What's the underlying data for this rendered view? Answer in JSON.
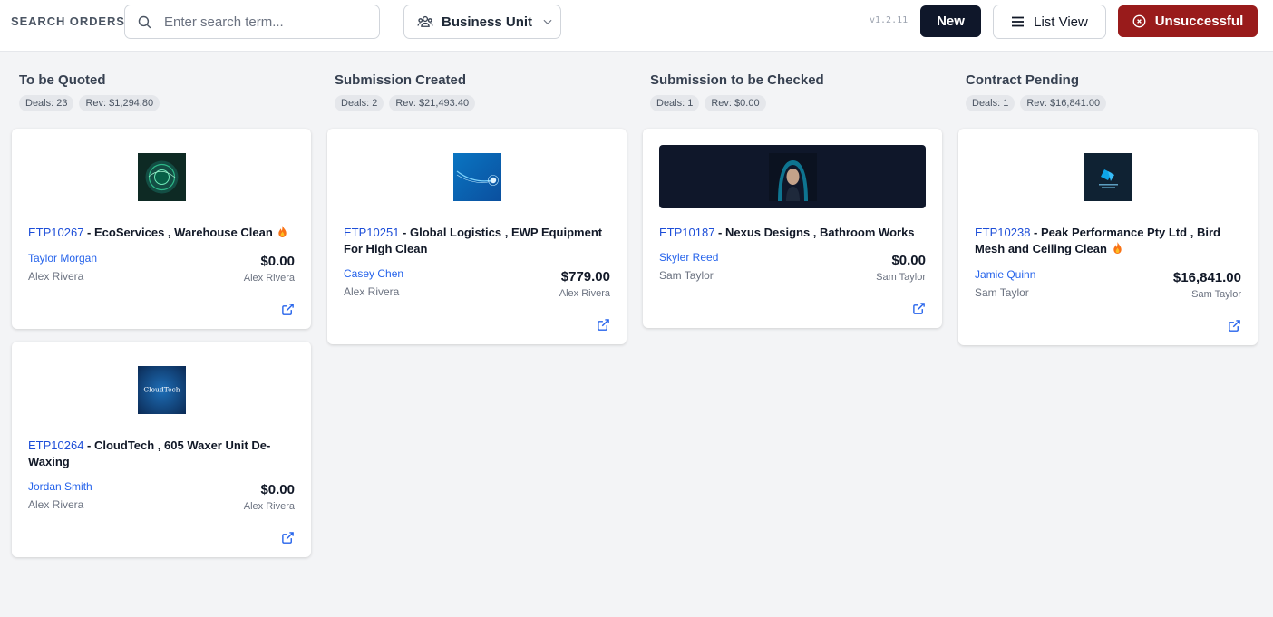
{
  "header": {
    "search_label": "SEARCH ORDERS:",
    "search_placeholder": "Enter search term...",
    "business_unit_label": "Business Unit",
    "version": "v1.2.11",
    "new_label": "New",
    "list_view_label": "List View",
    "unsuccessful_label": "Unsuccessful",
    "colors": {
      "primary_dark": "#0f172a",
      "danger": "#991b1b",
      "link": "#2563eb"
    }
  },
  "columns": [
    {
      "title": "To be Quoted",
      "deals": "Deals: 23",
      "rev": "Rev: $1,294.80",
      "cards": [
        {
          "code": "ETP10267",
          "title": " - EcoServices , Warehouse Clean",
          "hot": true,
          "client": "Taylor Morgan",
          "owner": "Alex Rivera",
          "amount": "$0.00",
          "owner_right": "Alex Rivera",
          "logo": "eco"
        },
        {
          "code": "ETP10264",
          "title": " - CloudTech , 605 Waxer Unit De-Waxing",
          "hot": false,
          "client": "Jordan Smith",
          "owner": "Alex Rivera",
          "amount": "$0.00",
          "owner_right": "Alex Rivera",
          "logo": "cloudtech",
          "logo_text": "CloudTech"
        }
      ]
    },
    {
      "title": "Submission Created",
      "deals": "Deals: 2",
      "rev": "Rev: $21,493.40",
      "cards": [
        {
          "code": "ETP10251",
          "title": " - Global Logistics , EWP Equipment For High Clean",
          "hot": false,
          "client": "Casey Chen",
          "owner": "Alex Rivera",
          "amount": "$779.00",
          "owner_right": "Alex Rivera",
          "logo": "global"
        }
      ]
    },
    {
      "title": "Submission to be Checked",
      "deals": "Deals: 1",
      "rev": "Rev: $0.00",
      "cards": [
        {
          "code": "ETP10187",
          "title": " - Nexus Designs , Bathroom Works",
          "hot": false,
          "client": "Skyler Reed",
          "owner": "Sam Taylor",
          "amount": "$0.00",
          "owner_right": "Sam Taylor",
          "logo": "nexus"
        }
      ]
    },
    {
      "title": "Contract Pending",
      "deals": "Deals: 1",
      "rev": "Rev: $16,841.00",
      "cards": [
        {
          "code": "ETP10238",
          "title": " - Peak Performance Pty Ltd , Bird Mesh and Ceiling Clean",
          "hot": true,
          "client": "Jamie Quinn",
          "owner": "Sam Taylor",
          "amount": "$16,841.00",
          "owner_right": "Sam Taylor",
          "logo": "peak"
        }
      ]
    }
  ]
}
